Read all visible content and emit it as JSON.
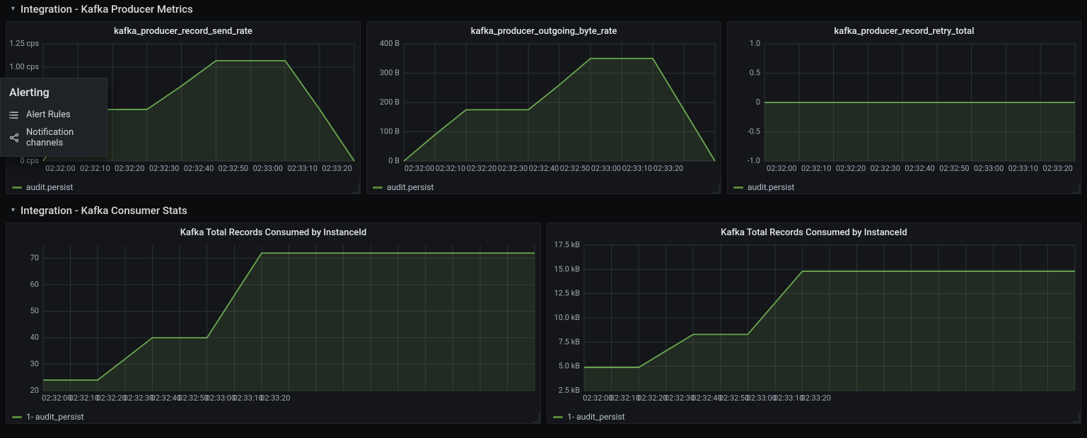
{
  "popover": {
    "title": "Alerting",
    "items": [
      {
        "label": "Alert Rules",
        "icon": "list-icon"
      },
      {
        "label": "Notification channels",
        "icon": "share-icon"
      }
    ]
  },
  "rows": [
    {
      "title": "Integration - Kafka Producer Metrics"
    },
    {
      "title": "Integration - Kafka Consumer Stats"
    }
  ],
  "colors": {
    "series": "#6aa84f",
    "grid": "#2c3036"
  },
  "chart_data": [
    {
      "id": "send_rate",
      "type": "line",
      "title": "kafka_producer_record_send_rate",
      "xlabel": "",
      "ylabel": "",
      "ylim": [
        0,
        1.25
      ],
      "y_unit": " cps",
      "y_ticks": [
        0,
        1.0,
        1.25
      ],
      "y_tick_labels": [
        "0 cps",
        "1.00 cps",
        "1.25 cps"
      ],
      "x_categories": [
        "02:32:00",
        "02:32:10",
        "02:32:20",
        "02:32:30",
        "02:32:40",
        "02:32:50",
        "02:33:00",
        "02:33:10",
        "02:33:20"
      ],
      "x_range_extra": 1,
      "series": [
        {
          "name": "audit.persist",
          "values": [
            0.0,
            0.55,
            0.55,
            0.55,
            0.8,
            1.07,
            1.07,
            1.07,
            0.55,
            0.0
          ]
        }
      ],
      "legend": [
        "audit.persist"
      ]
    },
    {
      "id": "outgoing_byte_rate",
      "type": "line",
      "title": "kafka_producer_outgoing_byte_rate",
      "xlabel": "",
      "ylabel": "",
      "ylim": [
        0,
        400
      ],
      "y_unit": " B",
      "y_ticks": [
        0,
        100,
        200,
        300,
        400
      ],
      "y_tick_labels": [
        "0 B",
        "100 B",
        "200 B",
        "300 B",
        "400 B"
      ],
      "x_categories": [
        "02:32:00",
        "02:32:10",
        "02:32:20",
        "02:32:30",
        "02:32:40",
        "02:32:50",
        "02:33:00",
        "02:33:10",
        "02:33:20"
      ],
      "x_range_extra": 1,
      "series": [
        {
          "name": "audit.persist",
          "values": [
            0,
            90,
            175,
            175,
            175,
            260,
            350,
            350,
            350,
            175,
            0
          ]
        }
      ],
      "legend": [
        "audit.persist"
      ]
    },
    {
      "id": "retry_total",
      "type": "line",
      "title": "kafka_producer_record_retry_total",
      "xlabel": "",
      "ylabel": "",
      "ylim": [
        -1.0,
        1.0
      ],
      "y_unit": "",
      "y_ticks": [
        -1.0,
        -0.5,
        0,
        0.5,
        1.0
      ],
      "y_tick_labels": [
        "-1.0",
        "-0.5",
        "0",
        "0.5",
        "1.0"
      ],
      "x_categories": [
        "02:32:00",
        "02:32:10",
        "02:32:20",
        "02:32:30",
        "02:32:40",
        "02:32:50",
        "02:33:00",
        "02:33:10",
        "02:33:20"
      ],
      "x_range_extra": 1,
      "series": [
        {
          "name": "audit.persist",
          "values": [
            0,
            0,
            0,
            0,
            0,
            0,
            0,
            0,
            0,
            0
          ]
        }
      ],
      "legend": [
        "audit.persist"
      ]
    },
    {
      "id": "records_consumed",
      "type": "line",
      "title": "Kafka Total Records Consumed by InstanceId",
      "xlabel": "",
      "ylabel": "",
      "ylim": [
        20,
        75
      ],
      "y_unit": "",
      "y_ticks": [
        20,
        30,
        40,
        50,
        60,
        70
      ],
      "y_tick_labels": [
        "20",
        "30",
        "40",
        "50",
        "60",
        "70"
      ],
      "x_categories": [
        "02:32:00",
        "02:32:10",
        "02:32:20",
        "02:32:30",
        "02:32:40",
        "02:32:50",
        "02:33:00",
        "02:33:10",
        "02:33:20"
      ],
      "x_range_extra": 1,
      "series": [
        {
          "name": "1- audit_persist",
          "values": [
            24,
            24,
            24,
            32,
            40,
            40,
            40,
            56,
            72,
            72,
            72,
            72,
            72,
            72,
            72,
            72,
            72,
            72,
            72
          ]
        }
      ],
      "legend": [
        "1- audit_persist"
      ]
    },
    {
      "id": "bytes_consumed",
      "type": "line",
      "title": "Kafka Total Records Consumed by InstanceId",
      "xlabel": "",
      "ylabel": "",
      "ylim": [
        2500,
        17500
      ],
      "y_unit": "",
      "y_ticks": [
        2500,
        5000,
        7500,
        10000,
        12500,
        15000,
        17500
      ],
      "y_tick_labels": [
        "2.5 kB",
        "5.0 kB",
        "7.5 kB",
        "10.0 kB",
        "12.5 kB",
        "15.0 kB",
        "17.5 kB"
      ],
      "x_categories": [
        "02:32:00",
        "02:32:10",
        "02:32:20",
        "02:32:30",
        "02:32:40",
        "02:32:50",
        "02:33:00",
        "02:33:10",
        "02:33:20"
      ],
      "x_range_extra": 1,
      "series": [
        {
          "name": "1- audit_persist",
          "values": [
            4900,
            4900,
            4900,
            6600,
            8300,
            8300,
            8300,
            11550,
            14800,
            14800,
            14800,
            14800,
            14800,
            14800,
            14800,
            14800,
            14800,
            14800,
            14800
          ]
        }
      ],
      "legend": [
        "1- audit_persist"
      ]
    }
  ]
}
